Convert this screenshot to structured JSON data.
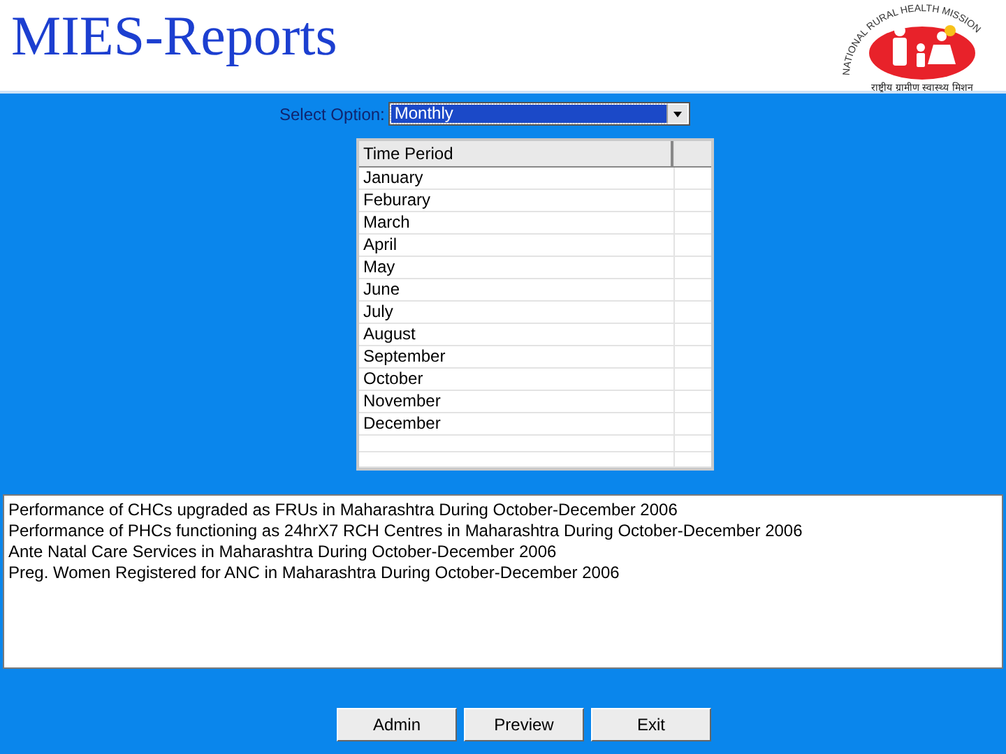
{
  "header": {
    "title": "MIES-Reports",
    "logo": {
      "arc_text": "NATIONAL RURAL HEALTH MISSION",
      "subtitle": "राष्ट्रीय ग्रामीण स्वास्थ्य मिशन"
    }
  },
  "select_option": {
    "label": "Select Option:",
    "value": "Monthly"
  },
  "time_period_table": {
    "columns": [
      "Time Period"
    ],
    "rows": [
      "January",
      "Feburary",
      "March",
      "April",
      "May",
      "June",
      "July",
      "August",
      "September",
      "October",
      "November",
      "December"
    ]
  },
  "reports": [
    "Performance of CHCs upgraded as FRUs in Maharashtra During October-December 2006",
    "Performance of PHCs functioning as 24hrX7 RCH Centres in Maharashtra During October-December 2006",
    "Ante Natal Care Services in Maharashtra During October-December 2006",
    "Preg. Women Registered for ANC in Maharashtra During October-December 2006"
  ],
  "buttons": [
    "Admin",
    "Preview",
    "Exit"
  ]
}
